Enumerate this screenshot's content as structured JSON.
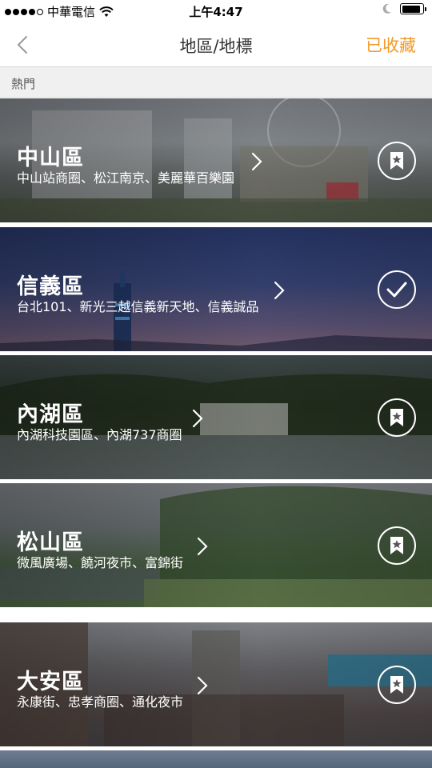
{
  "status_bar": {
    "carrier": "中華電信",
    "time": "上午4:47",
    "battery_level": 0.9
  },
  "nav": {
    "title": "地區/地標",
    "action_label": "已收藏",
    "accent_color": "#f39a2b"
  },
  "section": {
    "label": "熱門"
  },
  "districts": [
    {
      "name": "中山區",
      "landmarks": "中山站商圈、松江南京、美麗華百樂園",
      "action_icon": "bookmark-icon",
      "saved": false
    },
    {
      "name": "信義區",
      "landmarks": "台北101、新光三越信義新天地、信義誠品",
      "action_icon": "checkmark-icon",
      "saved": true
    },
    {
      "name": "內湖區",
      "landmarks": "內湖科技園區、內湖737商圈",
      "action_icon": "bookmark-icon",
      "saved": false
    },
    {
      "name": "松山區",
      "landmarks": "微風廣場、饒河夜市、富錦街",
      "action_icon": "bookmark-icon",
      "saved": false
    },
    {
      "name": "大安區",
      "landmarks": "永康街、忠孝商圈、通化夜市",
      "action_icon": "bookmark-icon",
      "saved": false
    }
  ]
}
